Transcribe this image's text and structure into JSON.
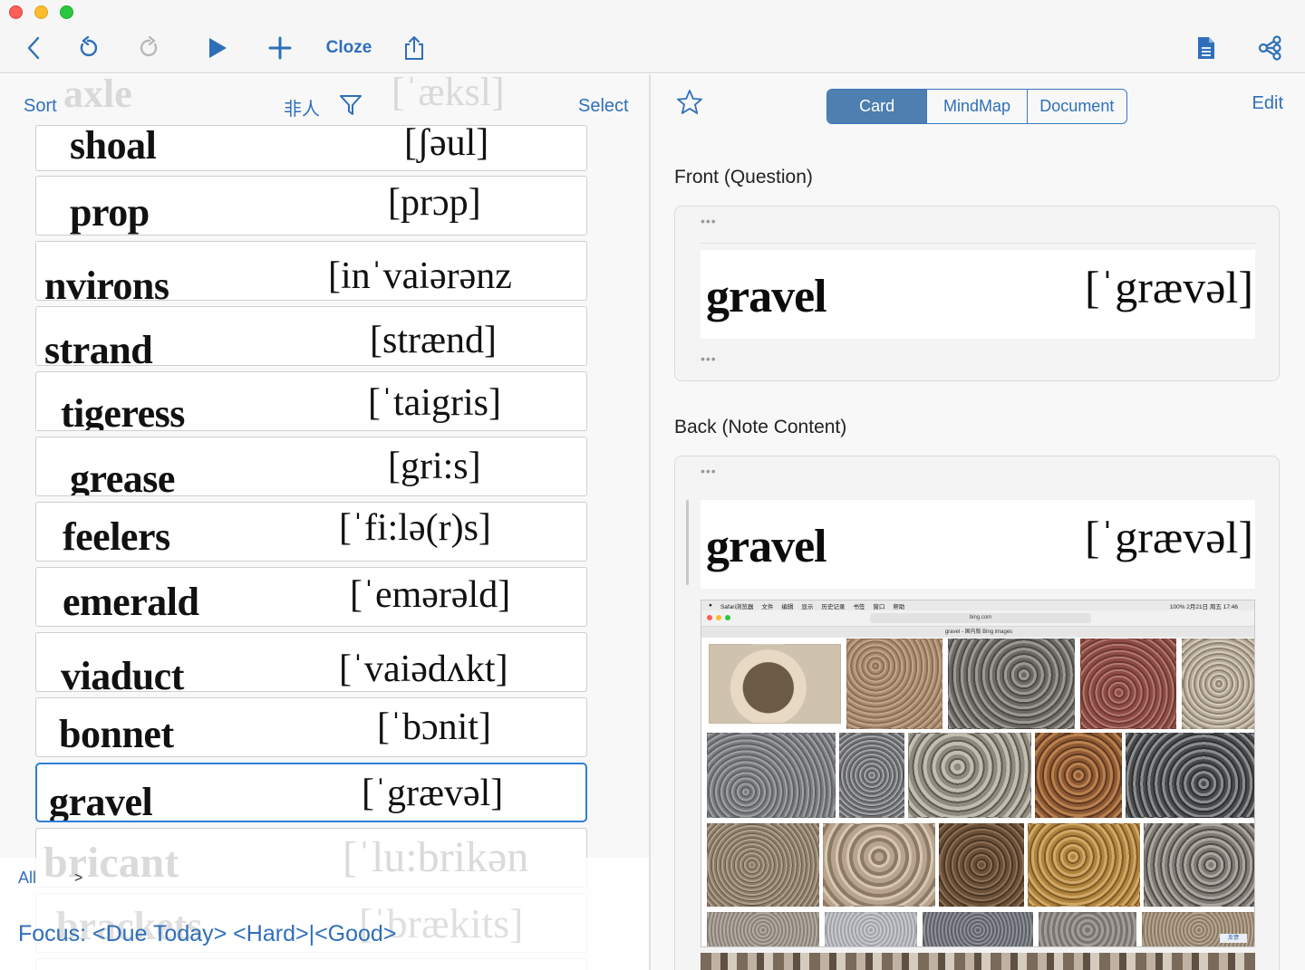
{
  "toolbar": {
    "back_icon": "chevron-left-icon",
    "undo_icon": "undo-icon",
    "redo_icon": "redo-icon",
    "play_icon": "play-icon",
    "add_icon": "plus-icon",
    "cloze_label": "Cloze",
    "share_icon": "share-icon",
    "document_icon": "document-icon",
    "mindmap_share_icon": "mindmap-share-icon"
  },
  "list_header": {
    "sort_label": "Sort",
    "filter_text": "非人",
    "filter_icon": "funnel-icon",
    "select_label": "Select",
    "ghost_word": "axle",
    "ghost_ipa": "[ˈæksl]"
  },
  "cards": [
    {
      "word": "shoal",
      "ipa": "[ʃəul]"
    },
    {
      "word": "prop",
      "ipa": "[prɔp]"
    },
    {
      "word": "nvirons",
      "ipa": "[inˈvaiərənz"
    },
    {
      "word": "strand",
      "ipa": "[strænd]"
    },
    {
      "word": "tigeress",
      "ipa": "[ˈtaigris]"
    },
    {
      "word": "grease",
      "ipa": "[gri:s]"
    },
    {
      "word": "feelers",
      "ipa": "[ˈfi:lə(r)s]"
    },
    {
      "word": "emerald",
      "ipa": "[ˈemərəld]"
    },
    {
      "word": "viaduct",
      "ipa": "[ˈvaiədʌkt]"
    },
    {
      "word": "bonnet",
      "ipa": "[ˈbɔnit]"
    },
    {
      "word": "gravel",
      "ipa": "[ˈgrævəl]",
      "selected": true
    }
  ],
  "footer": {
    "all_label": "All",
    "caret": ">",
    "focus_text": "Focus: <Due Today> <Hard>|<Good>",
    "ghost_word": "bricant",
    "ghost_ipa": "[ˈlu:brikən",
    "ghost_word2": "brackets",
    "ghost_ipa2": "[ˈbrækits]"
  },
  "detail": {
    "star_icon": "star-icon",
    "tabs": [
      "Card",
      "MindMap",
      "Document"
    ],
    "active_tab": "Card",
    "edit_label": "Edit",
    "front_label": "Front (Question)",
    "back_label": "Back (Note Content)",
    "dots": "•••",
    "front_word": "gravel",
    "front_ipa": "[ˈgrævəl]",
    "back_word": "gravel",
    "back_ipa": "[ˈgrævəl]",
    "embedded_screenshot": {
      "menu_items": [
        "Safari浏览器",
        "文件",
        "编辑",
        "显示",
        "历史记录",
        "书签",
        "窗口",
        "帮助"
      ],
      "clock": "100%  2月21日 周五 17:46",
      "url": "bing.com",
      "tab_title": "gravel - 国内版 Bing images",
      "feedback": "反馈"
    }
  },
  "colors": {
    "accent": "#2f6fba",
    "selected_border": "#2f7fd6",
    "segment_active": "#4d7fb0"
  }
}
